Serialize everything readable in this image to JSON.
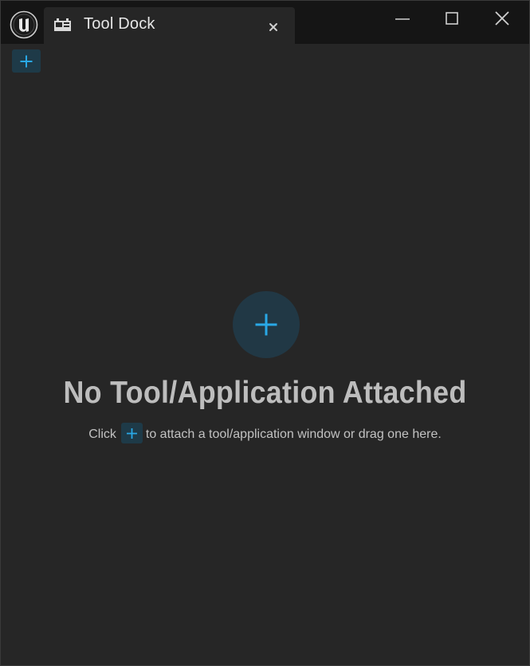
{
  "window": {
    "tab_title": "Tool Dock"
  },
  "icons": {
    "app_logo": "unreal-engine-logo-icon",
    "tab_icon": "tool-dock-icon",
    "tab_close": "close-icon",
    "minimize": "minimize-icon",
    "maximize": "maximize-icon",
    "close": "close-icon",
    "add": "plus-icon"
  },
  "colors": {
    "accent": "#29a8e6",
    "add_button_bg": "#1e3a48",
    "panel_bg": "#262626",
    "titlebar_bg": "#151515"
  },
  "empty_state": {
    "title": "No Tool/Application Attached",
    "hint_prefix": "Click",
    "hint_suffix": "to attach a tool/application window or drag one here."
  }
}
